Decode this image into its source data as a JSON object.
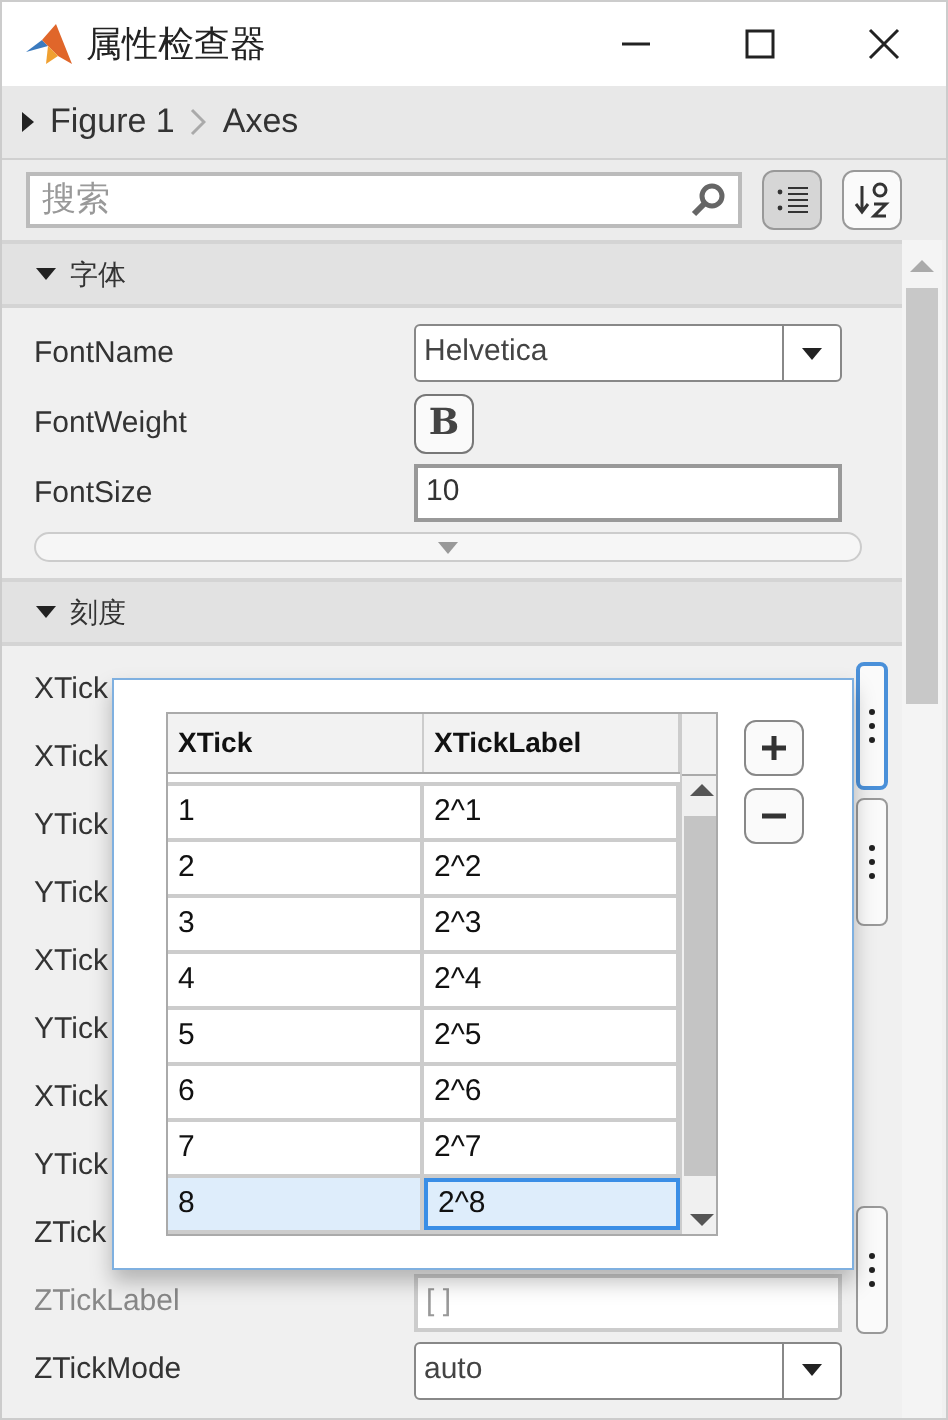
{
  "window": {
    "title": "属性检查器"
  },
  "breadcrumb": [
    {
      "label": "Figure 1",
      "expander": true
    },
    {
      "label": "Axes",
      "expander": false
    }
  ],
  "search": {
    "placeholder": "搜索"
  },
  "view_buttons": [
    {
      "kind": "categorized",
      "selected": true
    },
    {
      "kind": "alphabetical",
      "selected": false
    }
  ],
  "sections": [
    {
      "title": "字体",
      "expanded": true,
      "more_button": true,
      "properties": [
        {
          "label": "FontName",
          "kind": "dropdown",
          "value": "Helvetica"
        },
        {
          "label": "FontWeight",
          "kind": "toggle",
          "value": "B",
          "on": false
        },
        {
          "label": "FontSize",
          "kind": "text",
          "value": "10"
        }
      ]
    },
    {
      "title": "刻度",
      "expanded": true,
      "more_button": false,
      "properties": [
        {
          "label": "XTick",
          "kind": "matrix",
          "focused": true
        },
        {
          "label": "XTick",
          "kind": "covered"
        },
        {
          "label": "YTick",
          "kind": "matrix",
          "focused": false
        },
        {
          "label": "YTick",
          "kind": "covered"
        },
        {
          "label": "XTick",
          "kind": "covered"
        },
        {
          "label": "YTick",
          "kind": "covered"
        },
        {
          "label": "XTick",
          "kind": "covered"
        },
        {
          "label": "YTick",
          "kind": "covered"
        },
        {
          "label": "ZTick",
          "kind": "matrix",
          "focused": false
        },
        {
          "label": "ZTickLabel",
          "kind": "text",
          "value": "[ ]",
          "faded": true
        },
        {
          "label": "ZTickMode",
          "kind": "dropdown",
          "value": "auto"
        }
      ]
    }
  ],
  "editor": {
    "columns": [
      "XTick",
      "XTickLabel"
    ],
    "rows": [
      {
        "selected": false,
        "cells": [
          {
            "text": "1",
            "focused": false
          },
          {
            "text": "2^1",
            "focused": false
          }
        ]
      },
      {
        "selected": false,
        "cells": [
          {
            "text": "2",
            "focused": false
          },
          {
            "text": "2^2",
            "focused": false
          }
        ]
      },
      {
        "selected": false,
        "cells": [
          {
            "text": "3",
            "focused": false
          },
          {
            "text": "2^3",
            "focused": false
          }
        ]
      },
      {
        "selected": false,
        "cells": [
          {
            "text": "4",
            "focused": false
          },
          {
            "text": "2^4",
            "focused": false
          }
        ]
      },
      {
        "selected": false,
        "cells": [
          {
            "text": "5",
            "focused": false
          },
          {
            "text": "2^5",
            "focused": false
          }
        ]
      },
      {
        "selected": false,
        "cells": [
          {
            "text": "6",
            "focused": false
          },
          {
            "text": "2^6",
            "focused": false
          }
        ]
      },
      {
        "selected": false,
        "cells": [
          {
            "text": "7",
            "focused": false
          },
          {
            "text": "2^7",
            "focused": false
          }
        ]
      },
      {
        "selected": true,
        "cells": [
          {
            "text": "8",
            "focused": false
          },
          {
            "text": "2^8",
            "focused": true
          }
        ]
      }
    ],
    "buttons": [
      {
        "kind": "add"
      },
      {
        "kind": "remove"
      }
    ]
  }
}
